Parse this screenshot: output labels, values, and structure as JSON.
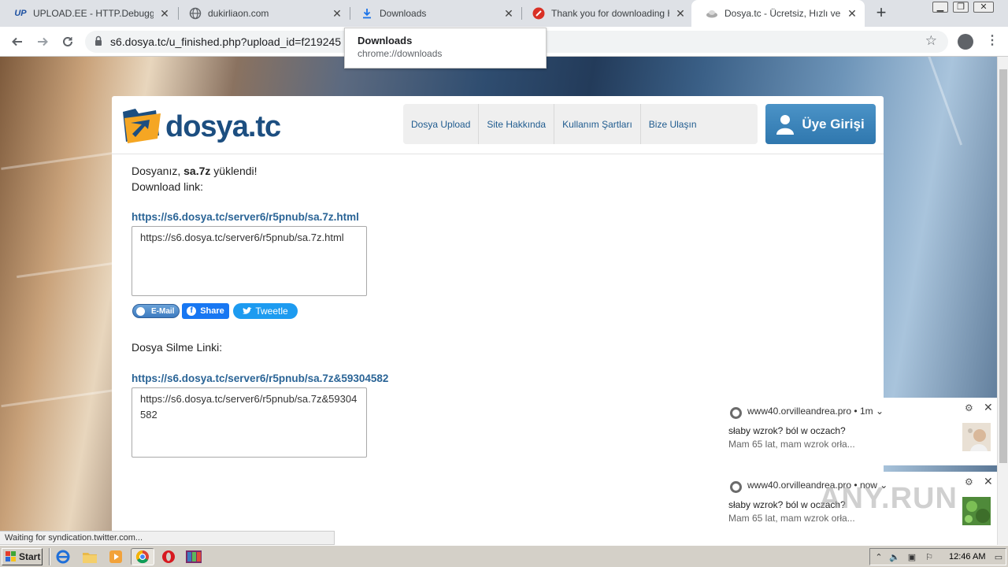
{
  "browser": {
    "tabs": [
      {
        "title": "UPLOAD.EE - HTTP.Debugger.Pr",
        "favicon": "upload-ee-icon",
        "favicon_text": "UP"
      },
      {
        "title": "dukirliaon.com",
        "favicon": "globe-icon"
      },
      {
        "title": "Downloads",
        "favicon": "download-icon"
      },
      {
        "title": "Thank you for downloading HTT",
        "favicon": "red-round-icon"
      },
      {
        "title": "Dosya.tc - Ücretsiz, Hızlı ve Kola",
        "favicon": "dosya-icon",
        "active": true
      }
    ],
    "url": "s6.dosya.tc/u_finished.php?upload_id=f219245",
    "tooltip": {
      "title": "Downloads",
      "subtitle": "chrome://downloads"
    },
    "status_text": "Waiting for syndication.twitter.com..."
  },
  "site": {
    "logo_text": "dosya.tc",
    "nav": [
      "Dosya Upload",
      "Site Hakkında",
      "Kullanım Şartları",
      "Bize Ulaşın"
    ],
    "login_label": "Üye Girişi",
    "message_prefix": "Dosyanız, ",
    "file_name": "sa.7z",
    "message_suffix": " yüklendi!",
    "download_label": "Download link:",
    "download_link": "https://s6.dosya.tc/server6/r5pnub/sa.7z.html",
    "download_box": "https://s6.dosya.tc/server6/r5pnub/sa.7z.html",
    "share": {
      "email": "E-Mail",
      "facebook": "Share",
      "twitter": "Tweetle"
    },
    "delete_label": "Dosya Silme Linki:",
    "delete_link": "https://s6.dosya.tc/server6/r5pnub/sa.7z&59304582",
    "delete_box": "https://s6.dosya.tc/server6/r5pnub/sa.7z&59304582"
  },
  "notifications": [
    {
      "source": "www40.orvilleandrea.pro",
      "time": "• 1m ⌄",
      "title": "słaby wzrok? ból w oczach?",
      "body": "Mam 65 lat, mam wzrok orła..."
    },
    {
      "source": "www40.orvilleandrea.pro",
      "time": "• now ⌄",
      "title": "słaby wzrok? ból w oczach?",
      "body": "Mam 65 lat, mam wzrok orła..."
    }
  ],
  "watermark": "ANY.RUN",
  "taskbar": {
    "start_label": "Start",
    "clock": "12:46 AM"
  },
  "colors": {
    "link": "#2a6496",
    "login_button": "#3a84bb",
    "logo": "#1c4e80"
  }
}
